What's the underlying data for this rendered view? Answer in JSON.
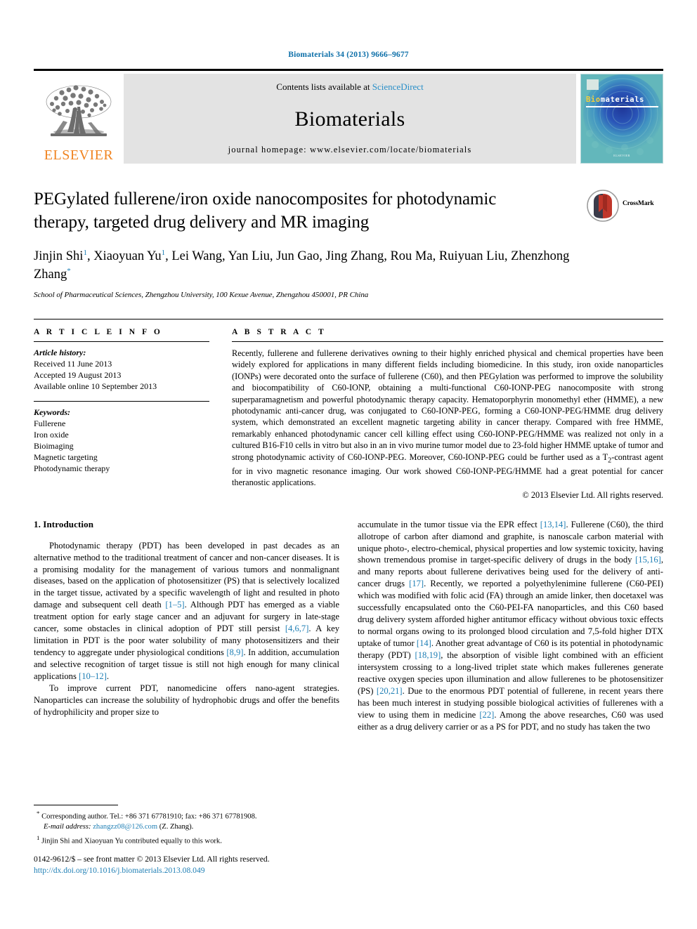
{
  "running_head": "Biomaterials 34 (2013) 9666–9677",
  "masthead": {
    "publisher_logo_text": "ELSEVIER",
    "contents_prefix": "Contents lists available at",
    "contents_link": "ScienceDirect",
    "journal_name": "Biomaterials",
    "homepage_line": "journal homepage: www.elsevier.com/locate/biomaterials",
    "cover": {
      "title_first": "Bio",
      "title_rest": "materials",
      "footer": "ELSEVIER"
    }
  },
  "article": {
    "title": "PEGylated fullerene/iron oxide nanocomposites for photodynamic therapy, targeted drug delivery and MR imaging",
    "crossmark_label": "CrossMark",
    "authors_line1_pre": "Jinjin Shi",
    "authors_line1_mark1": "1",
    "authors_line1_mid": ", Xiaoyuan Yu",
    "authors_line1_mark2": "1",
    "authors_line1_post": ", Lei Wang, Yan Liu, Jun Gao, Jing Zhang, Rou Ma, Ruiyuan Liu,",
    "authors_line2": "Zhenzhong Zhang",
    "authors_line2_mark": "*",
    "affiliation": "School of Pharmaceutical Sciences, Zhengzhou University, 100 Kexue Avenue, Zhengzhou 450001, PR China"
  },
  "article_info": {
    "heading": "A R T I C L E   I N F O",
    "history_label": "Article history:",
    "history": [
      "Received 11 June 2013",
      "Accepted 19 August 2013",
      "Available online 10 September 2013"
    ],
    "keywords_label": "Keywords:",
    "keywords": [
      "Fullerene",
      "Iron oxide",
      "Bioimaging",
      "Magnetic targeting",
      "Photodynamic therapy"
    ]
  },
  "abstract": {
    "heading": "A B S T R A C T",
    "text": "Recently, fullerene and fullerene derivatives owning to their highly enriched physical and chemical properties have been widely explored for applications in many different fields including biomedicine. In this study, iron oxide nanoparticles (IONPs) were decorated onto the surface of fullerene (C60), and then PEGylation was performed to improve the solubility and biocompatibility of C60-IONP, obtaining a multi-functional C60-IONP-PEG nanocomposite with strong superparamagnetism and powerful photodynamic therapy capacity. Hematoporphyrin monomethyl ether (HMME), a new photodynamic anti-cancer drug, was conjugated to C60-IONP-PEG, forming a C60-IONP-PEG/HMME drug delivery system, which demonstrated an excellent magnetic targeting ability in cancer therapy. Compared with free HMME, remarkably enhanced photodynamic cancer cell killing effect using C60-IONP-PEG/HMME was realized not only in a cultured B16-F10 cells in vitro but also in an in vivo murine tumor model due to 23-fold higher HMME uptake of tumor and strong photodynamic activity of C60-IONP-PEG. Moreover, C60-IONP-PEG could be further used as a T2-contrast agent for in vivo magnetic resonance imaging. Our work showed C60-IONP-PEG/HMME had a great potential for cancer theranostic applications.",
    "copyright": "© 2013 Elsevier Ltd. All rights reserved."
  },
  "introduction": {
    "heading": "1. Introduction",
    "left_paragraph_1_a": "Photodynamic therapy (PDT) has been developed in past decades as an alternative method to the traditional treatment of cancer and non-cancer diseases. It is a promising modality for the management of various tumors and nonmalignant diseases, based on the application of photosensitizer (PS) that is selectively localized in the target tissue, activated by a specific wavelength of light and resulted in photo damage and subsequent cell death ",
    "cite_1_5": "[1–5]",
    "left_paragraph_1_b": ". Although PDT has emerged as a viable treatment option for early stage cancer and an adjuvant for surgery in late-stage cancer, some obstacles in clinical adoption of PDT still persist ",
    "cite_4_6_7": "[4,6,7]",
    "left_paragraph_1_c": ". A key limitation in PDT is the poor water solubility of many photosensitizers and their tendency to aggregate under physiological conditions ",
    "cite_8_9": "[8,9]",
    "left_paragraph_1_d": ". In addition, accumulation and selective recognition of target tissue is still not high enough for many clinical applications ",
    "cite_10_12": "[10–12]",
    "left_paragraph_1_e": ".",
    "left_paragraph_2": "To improve current PDT, nanomedicine offers nano-agent strategies. Nanoparticles can increase the solubility of hydrophobic drugs and offer the benefits of hydrophilicity and proper size to",
    "right_paragraph_a": "accumulate in the tumor tissue via the EPR effect ",
    "cite_13_14": "[13,14]",
    "right_paragraph_b": ". Fullerene (C60), the third allotrope of carbon after diamond and graphite, is nanoscale carbon material with unique photo-, electro-chemical, physical properties and low systemic toxicity, having shown tremendous promise in target-specific delivery of drugs in the body ",
    "cite_15_16": "[15,16]",
    "right_paragraph_c": ", and many reports about fullerene derivatives being used for the delivery of anti-cancer drugs ",
    "cite_17": "[17]",
    "right_paragraph_d": ". Recently, we reported a polyethylenimine fullerene (C60-PEI) which was modified with folic acid (FA) through an amide linker, then docetaxel was successfully encapsulated onto the C60-PEI-FA nanoparticles, and this C60 based drug delivery system afforded higher antitumor efficacy without obvious toxic effects to normal organs owing to its prolonged blood circulation and 7,5-fold higher DTX uptake of tumor ",
    "cite_14": "[14]",
    "right_paragraph_e": ". Another great advantage of C60 is its potential in photodynamic therapy (PDT) ",
    "cite_18_19": "[18,19]",
    "right_paragraph_f": ", the absorption of visible light combined with an efficient intersystem crossing to a long-lived triplet state which makes fullerenes generate reactive oxygen species upon illumination and allow fullerenes to be photosensitizer (PS) ",
    "cite_20_21": "[20,21]",
    "right_paragraph_g": ". Due to the enormous PDT potential of fullerene, in recent years there has been much interest in studying possible biological activities of fullerenes with a view to using them in medicine ",
    "cite_22": "[22]",
    "right_paragraph_h": ". Among the above researches, C60 was used either as a drug delivery carrier or as a PS for PDT, and no study has taken the two"
  },
  "footnotes": {
    "corresponding_mark": "*",
    "corresponding_text": "Corresponding author. Tel.: +86 371 67781910; fax: +86 371 67781908.",
    "email_label": "E-mail address:",
    "email": "zhangzz08@126.com",
    "email_suffix": "(Z. Zhang).",
    "equal_mark": "1",
    "equal_text": "Jinjin Shi and Xiaoyuan Yu contributed equally to this work."
  },
  "imprint": {
    "line1": "0142-9612/$ – see front matter © 2013 Elsevier Ltd. All rights reserved.",
    "doi": "http://dx.doi.org/10.1016/j.biomaterials.2013.08.049"
  },
  "colors": {
    "link_blue": "#1f7fb5",
    "header_blue": "#0b6ea8",
    "elsevier_orange": "#f08421",
    "band_gray": "#e3e3e3",
    "cover_teal": "#63b7bb",
    "cover_blue": "#1b2f96"
  }
}
